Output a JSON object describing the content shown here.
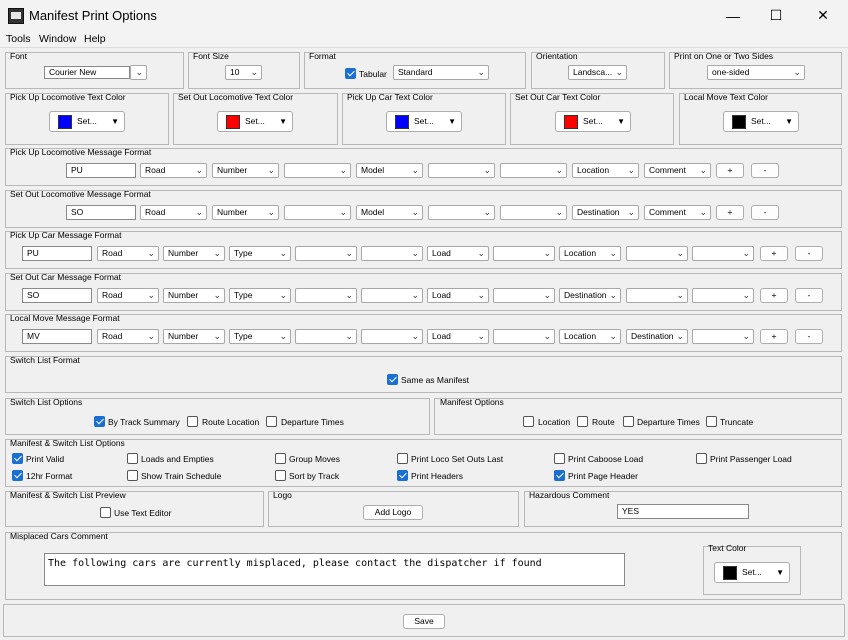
{
  "window": {
    "title": "Manifest Print Options",
    "minimize": "—",
    "maximize": "☐",
    "close": "✕"
  },
  "menu": [
    "Tools",
    "Window",
    "Help"
  ],
  "font": {
    "label": "Font",
    "value": "Courier New"
  },
  "font_size": {
    "label": "Font Size",
    "value": "10"
  },
  "format": {
    "label": "Format",
    "tabular_label": "Tabular",
    "tabular_checked": true,
    "value": "Standard"
  },
  "orientation": {
    "label": "Orientation",
    "value": "Landsca..."
  },
  "sides": {
    "label": "Print on One or Two Sides",
    "value": "one-sided"
  },
  "colors": [
    {
      "label": "Pick Up Locomotive Text Color",
      "color": "#0000ff",
      "button": "Set..."
    },
    {
      "label": "Set Out Locomotive Text Color",
      "color": "#ff0000",
      "button": "Set..."
    },
    {
      "label": "Pick Up Car Text Color",
      "color": "#0000ff",
      "button": "Set..."
    },
    {
      "label": "Set Out Car Text Color",
      "color": "#ff0000",
      "button": "Set..."
    },
    {
      "label": "Local Move Text Color",
      "color": "#000000",
      "button": "Set..."
    }
  ],
  "formats": [
    {
      "label": "Pick Up Locomotive Message Format",
      "prefix": "PU",
      "fields": [
        "Road",
        "Number",
        "",
        "Model",
        "",
        "",
        "Location",
        "Comment"
      ]
    },
    {
      "label": "Set Out Locomotive Message Format",
      "prefix": "SO",
      "fields": [
        "Road",
        "Number",
        "",
        "Model",
        "",
        "",
        "Destination",
        "Comment"
      ]
    },
    {
      "label": "Pick Up Car Message Format",
      "prefix": "PU",
      "fields": [
        "Road",
        "Number",
        "Type",
        "",
        "",
        "Load",
        "",
        "Location",
        "",
        ""
      ]
    },
    {
      "label": "Set Out Car Message Format",
      "prefix": "SO",
      "fields": [
        "Road",
        "Number",
        "Type",
        "",
        "",
        "Load",
        "",
        "Destination",
        "",
        ""
      ]
    },
    {
      "label": "Local Move Message Format",
      "prefix": "MV",
      "fields": [
        "Road",
        "Number",
        "Type",
        "",
        "",
        "Load",
        "",
        "Location",
        "Destination",
        ""
      ]
    }
  ],
  "plus": "+",
  "minus": "-",
  "switch_list_format": {
    "label": "Switch List Format",
    "same_as_manifest": "Same as Manifest",
    "checked": true
  },
  "switch_list_options": {
    "label": "Switch List Options",
    "items": [
      {
        "label": "By Track Summary",
        "checked": true
      },
      {
        "label": "Route Location",
        "checked": false
      },
      {
        "label": "Departure Times",
        "checked": false
      }
    ]
  },
  "manifest_options": {
    "label": "Manifest Options",
    "items": [
      {
        "label": "Location",
        "checked": false
      },
      {
        "label": "Route",
        "checked": false
      },
      {
        "label": "Departure Times",
        "checked": false
      },
      {
        "label": "Truncate",
        "checked": false
      }
    ]
  },
  "ms_options": {
    "label": "Manifest & Switch List Options",
    "items": [
      {
        "label": "Print Valid",
        "checked": true
      },
      {
        "label": "Loads and Empties",
        "checked": false
      },
      {
        "label": "Group Moves",
        "checked": false
      },
      {
        "label": "Print Loco Set Outs Last",
        "checked": false
      },
      {
        "label": "Print Caboose Load",
        "checked": false
      },
      {
        "label": "Print Passenger Load",
        "checked": false
      },
      {
        "label": "12hr Format",
        "checked": true
      },
      {
        "label": "Show Train Schedule",
        "checked": false
      },
      {
        "label": "Sort by Track",
        "checked": false
      },
      {
        "label": "Print Headers",
        "checked": true
      },
      {
        "label": "Print Page Header",
        "checked": true
      }
    ]
  },
  "preview": {
    "label": "Manifest & Switch List Preview",
    "use_text_editor": "Use Text Editor",
    "checked": false
  },
  "logo": {
    "label": "Logo",
    "button": "Add Logo"
  },
  "hazardous": {
    "label": "Hazardous Comment",
    "value": "YES"
  },
  "misplaced": {
    "label": "Misplaced Cars Comment",
    "value": "The following cars are currently misplaced, please contact the dispatcher if found",
    "text_color_label": "Text Color",
    "color": "#000000",
    "button": "Set..."
  },
  "save": "Save"
}
